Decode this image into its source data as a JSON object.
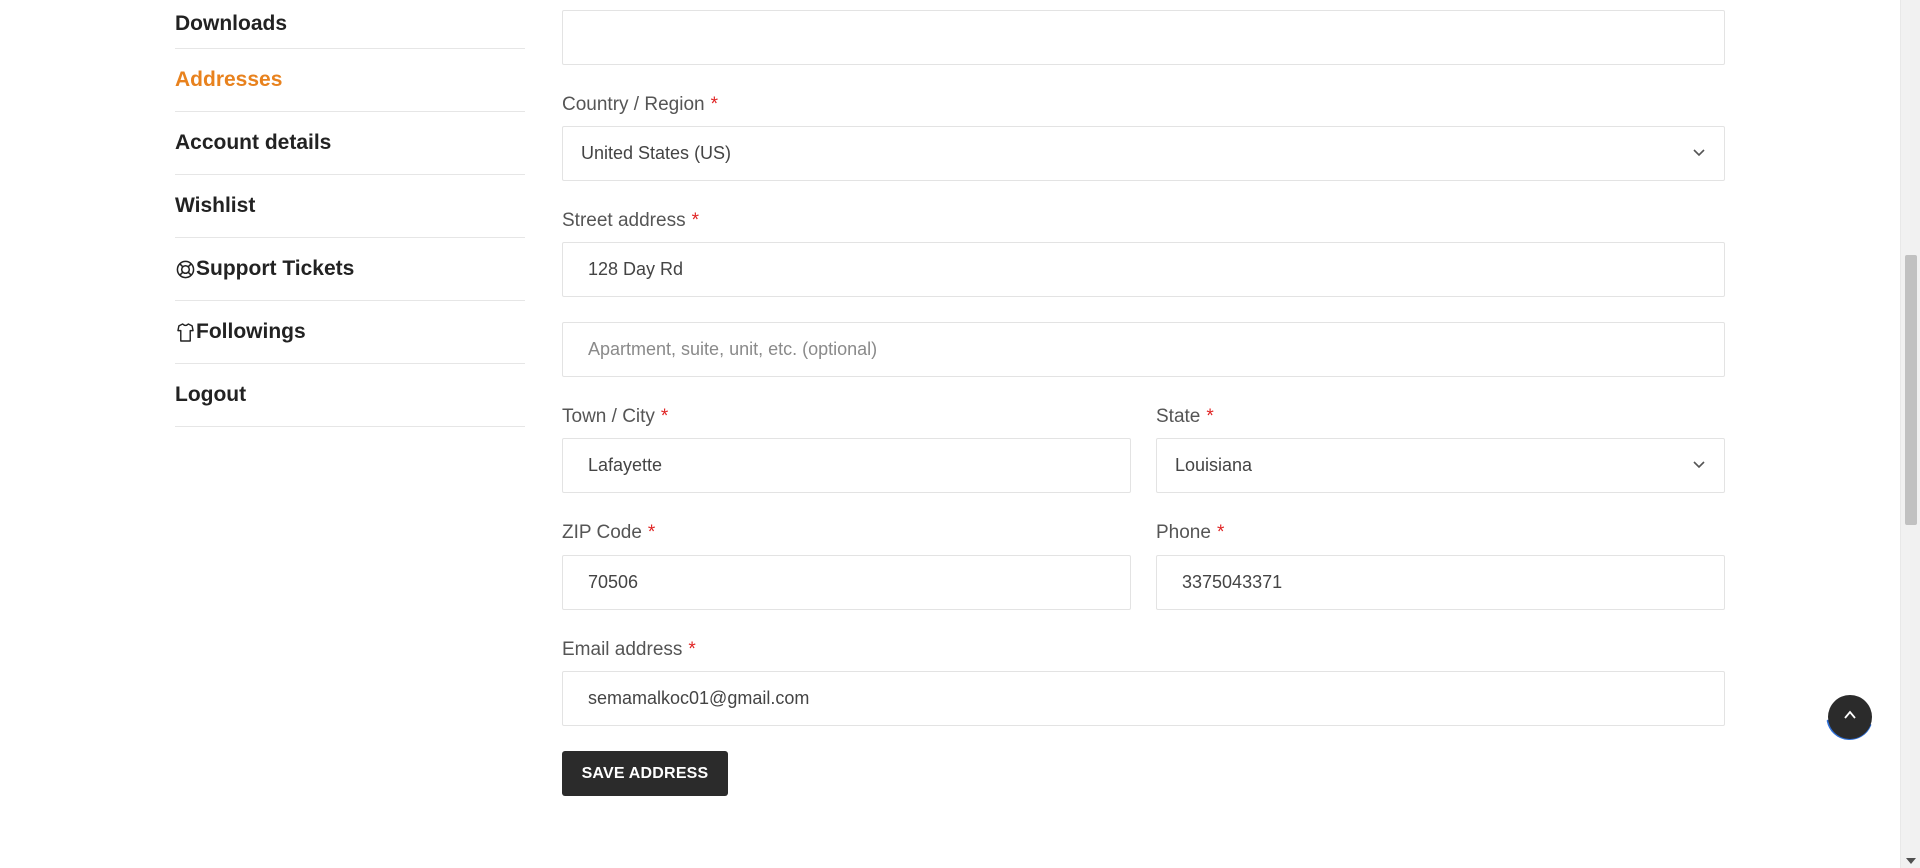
{
  "sidebar": {
    "items": [
      {
        "label": "Downloads",
        "active": false
      },
      {
        "label": "Addresses",
        "active": true
      },
      {
        "label": "Account details",
        "active": false
      },
      {
        "label": "Wishlist",
        "active": false
      },
      {
        "label": "Support Tickets",
        "active": false,
        "icon": "lifebuoy-icon"
      },
      {
        "label": "Followings",
        "active": false,
        "icon": "shirt-icon"
      },
      {
        "label": "Logout",
        "active": false
      }
    ]
  },
  "form": {
    "country": {
      "label": "Country / Region",
      "required": "*",
      "value": "United States (US)"
    },
    "street": {
      "label": "Street address",
      "required": "*",
      "value": "128 Day Rd"
    },
    "street2": {
      "placeholder": "Apartment, suite, unit, etc. (optional)",
      "value": ""
    },
    "city": {
      "label": "Town / City",
      "required": "*",
      "value": "Lafayette"
    },
    "state": {
      "label": "State",
      "required": "*",
      "value": "Louisiana"
    },
    "zip": {
      "label": "ZIP Code",
      "required": "*",
      "value": "70506"
    },
    "phone": {
      "label": "Phone",
      "required": "*",
      "value": "3375043371"
    },
    "email": {
      "label": "Email address",
      "required": "*",
      "value": "semamalkoc01@gmail.com"
    },
    "save_label": "SAVE ADDRESS"
  },
  "colors": {
    "accent": "#e8821e",
    "required": "#e02424",
    "button": "#2b2b2b",
    "back_to_top_ring": "#2f6fd6"
  }
}
